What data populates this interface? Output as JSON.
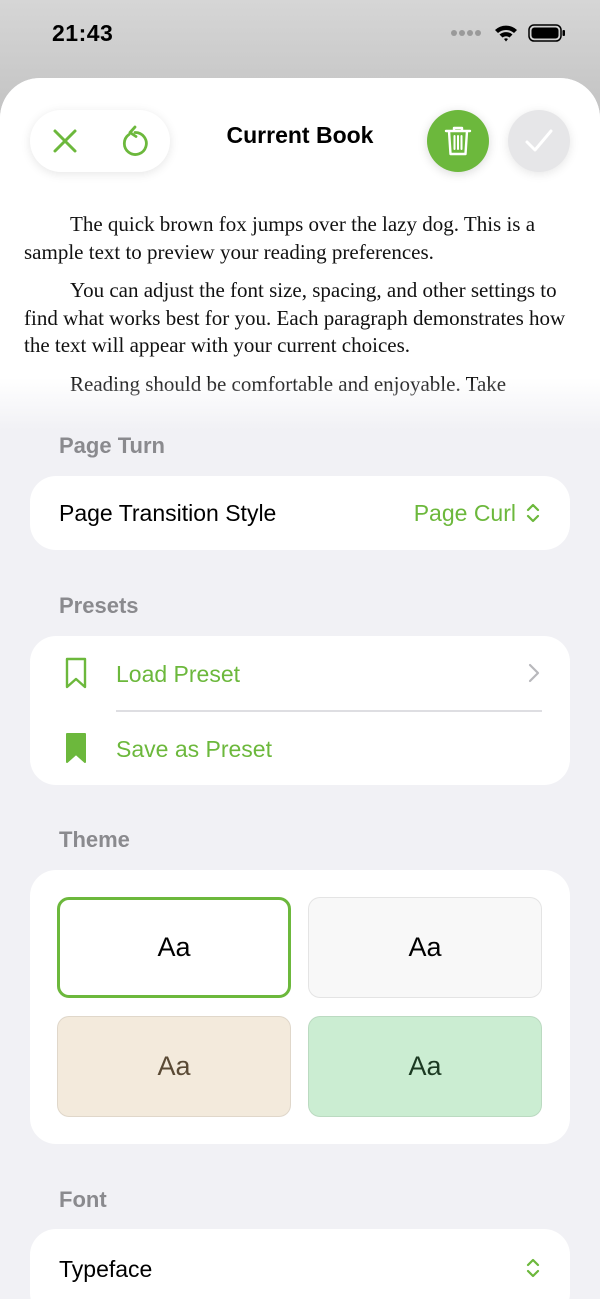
{
  "status": {
    "time": "21:43"
  },
  "header": {
    "title": "Current Book"
  },
  "preview": {
    "paragraphs": [
      "The quick brown fox jumps over the lazy dog. This is a sample text to preview your reading preferences.",
      "You can adjust the font size, spacing, and other settings to find what works best for you. Each paragraph demonstrates how the text will appear with your current choices.",
      "Reading should be comfortable and enjoyable. Take"
    ]
  },
  "page_turn": {
    "header": "Page Turn",
    "row_label": "Page Transition Style",
    "row_value": "Page Curl"
  },
  "presets": {
    "header": "Presets",
    "load_label": "Load Preset",
    "save_label": "Save as Preset"
  },
  "theme": {
    "header": "Theme",
    "tiles": [
      {
        "label": "Aa",
        "bg": "#ffffff",
        "text": "#000000",
        "selected": true
      },
      {
        "label": "Aa",
        "bg": "#f8f8f8",
        "text": "#000000",
        "selected": false
      },
      {
        "label": "Aa",
        "bg": "#f3eadc",
        "text": "#5a4a35",
        "selected": false
      },
      {
        "label": "Aa",
        "bg": "#cbedd2",
        "text": "#1c3a22",
        "selected": false
      }
    ]
  },
  "font": {
    "header": "Font",
    "typeface_label": "Typeface"
  },
  "colors": {
    "accent": "#6cb83c",
    "sheet_bg": "#f1f1f5",
    "secondary_text": "#8a8a8e"
  }
}
